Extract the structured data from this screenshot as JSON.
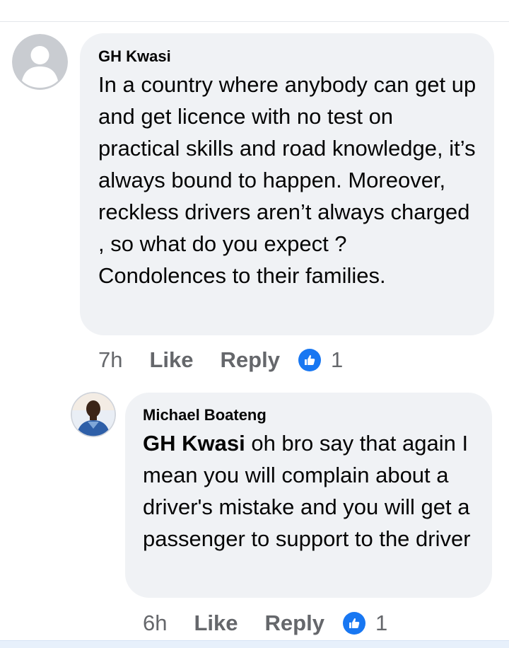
{
  "comments": [
    {
      "author": "GH Kwasi",
      "text": "In a country where anybody can get up and get licence with no test on practical skills and road knowledge, it’s always bound to happen. Moreover, reckless drivers aren’t always charged , so what do you expect ? Condolences to their families.",
      "time": "7h",
      "like_label": "Like",
      "reply_label": "Reply",
      "reaction_count": "1"
    }
  ],
  "reply": {
    "author": "Michael Boateng",
    "mention": "GH Kwasi",
    "text": " oh bro say that again I mean you will complain about a driver's mistake and you will get a passenger to support to the driver",
    "time": "6h",
    "like_label": "Like",
    "reply_label": "Reply",
    "reaction_count": "1"
  },
  "colors": {
    "bubble": "#f0f2f5",
    "meta": "#65676b",
    "like_blue": "#1877f2"
  },
  "icons": {
    "reaction": "thumbs-up-icon",
    "default_avatar": "default-profile-avatar-icon",
    "user_avatar": "user-photo-avatar-icon"
  }
}
